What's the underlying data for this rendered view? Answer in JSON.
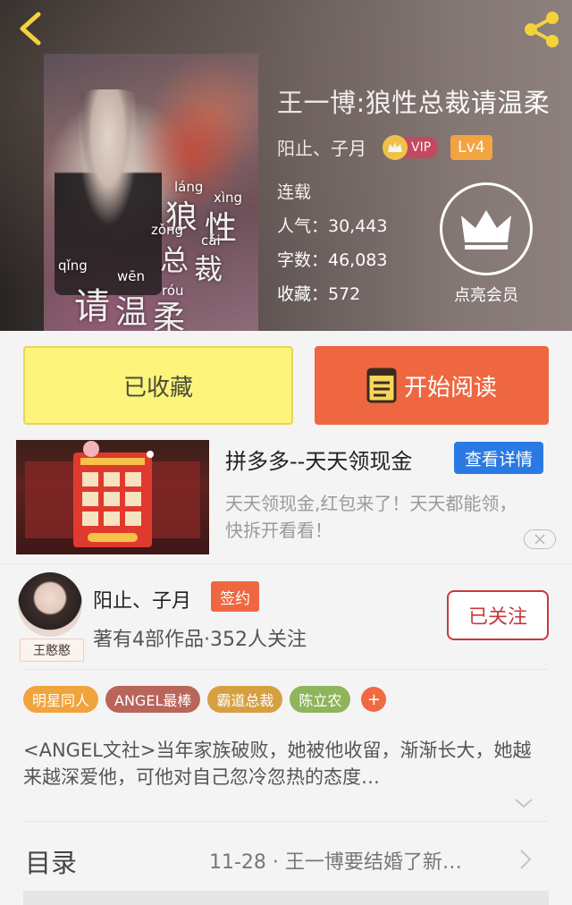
{
  "header": {
    "book_title": "王一博:狼性总裁请温柔",
    "author_line": "阳止、子月",
    "vip_label": "VIP",
    "level_label": "Lv4",
    "status": "连载",
    "popularity_label": "人气：30,443",
    "word_count_label": "字数：46,083",
    "favorites_label": "收藏：572",
    "member_button_label": "点亮会员",
    "cover": {
      "title_chars": [
        "狼",
        "性",
        "总",
        "裁",
        "请",
        "温",
        "柔"
      ],
      "pinyin": [
        "láng",
        "xìng",
        "zǒng",
        "cái",
        "qǐng",
        "wēn",
        "róu"
      ]
    }
  },
  "actions": {
    "collected_label": "已收藏",
    "start_reading_label": "开始阅读"
  },
  "ad": {
    "title": "拼多多--天天领现金",
    "detail_button": "查看详情",
    "description": "天天领现金,红包来了！天天都能领，快拆开看看！"
  },
  "author": {
    "name": "阳止、子月",
    "sign_badge": "签约",
    "stats": "著有4部作品·352人关注",
    "follow_button": "已关注",
    "avatar_sticker": "王憨憨"
  },
  "tags": [
    {
      "label": "明星同人",
      "color": "#f0a43c"
    },
    {
      "label": "ANGEL最棒",
      "color": "#b9655a"
    },
    {
      "label": "霸道总裁",
      "color": "#d6a041"
    },
    {
      "label": "陈立农",
      "color": "#8fb45c"
    }
  ],
  "synopsis": "<ANGEL文社>当年家族破败，她被他收留，渐渐长大，她越来越深爱他，可他对自己忽冷忽热的态度…",
  "toc": {
    "label": "目录",
    "latest": "11-28 · 王一博要结婚了新…"
  },
  "colors": {
    "accent_orange": "#ee6740",
    "collected_yellow": "#fdf47c",
    "ad_blue": "#2b7ae3",
    "follow_red": "#c8393a",
    "back_arrow": "#f2d33c"
  }
}
